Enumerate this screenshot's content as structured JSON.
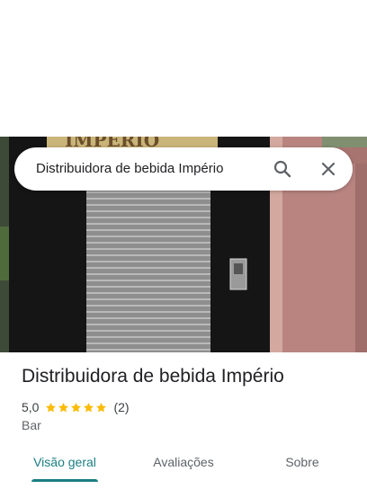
{
  "search": {
    "query": "Distribuidora de bebida Império"
  },
  "photo": {
    "sign_text": "IMPÉRIO"
  },
  "place": {
    "name": "Distribuidora de bebida Império",
    "rating": "5,0",
    "stars": 5,
    "review_count": "(2)",
    "category": "Bar"
  },
  "tabs": [
    {
      "label": "Visão geral",
      "active": true
    },
    {
      "label": "Avaliações",
      "active": false
    },
    {
      "label": "Sobre",
      "active": false
    }
  ],
  "colors": {
    "accent": "#1a7e84",
    "star": "#fbbc04"
  },
  "icons": {
    "search": "search-icon",
    "close": "close-icon",
    "star": "star-icon"
  }
}
